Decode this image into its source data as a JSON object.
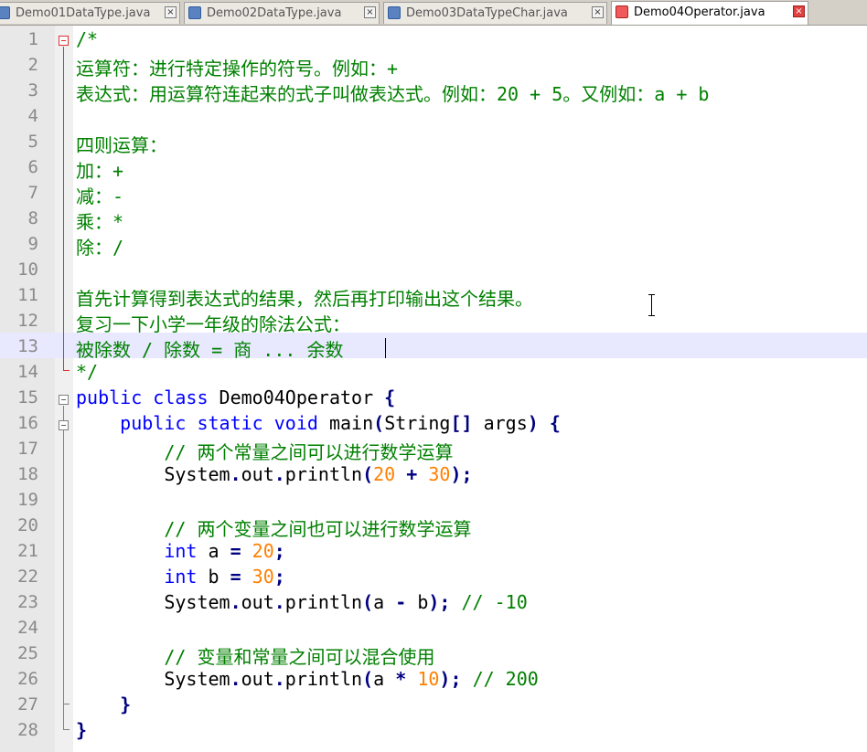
{
  "tabs": [
    {
      "label": "Demo01DataType.java",
      "active": false
    },
    {
      "label": "Demo02DataType.java",
      "active": false
    },
    {
      "label": "Demo03DataTypeChar.java",
      "active": false
    },
    {
      "label": "Demo04Operator.java",
      "active": true
    }
  ],
  "tab_close_glyph": "×",
  "colors": {
    "comment": "#008000",
    "keyword": "#0000ff",
    "number": "#ff8000",
    "operator": "#000080",
    "current_line": "#e8e8ff",
    "fold_marker": "#e03030"
  },
  "editor": {
    "current_line": 13,
    "lines": [
      {
        "n": "1",
        "tokens": [
          {
            "t": "/*",
            "c": "cmt"
          }
        ]
      },
      {
        "n": "2",
        "tokens": [
          {
            "t": "运算符：进行特定操作的符号。例如：+",
            "c": "cmt"
          }
        ]
      },
      {
        "n": "3",
        "tokens": [
          {
            "t": "表达式：用运算符连起来的式子叫做表达式。例如：20 + 5。又例如：a + b",
            "c": "cmt"
          }
        ]
      },
      {
        "n": "4",
        "tokens": []
      },
      {
        "n": "5",
        "tokens": [
          {
            "t": "四则运算：",
            "c": "cmt"
          }
        ]
      },
      {
        "n": "6",
        "tokens": [
          {
            "t": "加：+",
            "c": "cmt"
          }
        ]
      },
      {
        "n": "7",
        "tokens": [
          {
            "t": "减：-",
            "c": "cmt"
          }
        ]
      },
      {
        "n": "8",
        "tokens": [
          {
            "t": "乘：*",
            "c": "cmt"
          }
        ]
      },
      {
        "n": "9",
        "tokens": [
          {
            "t": "除：/",
            "c": "cmt"
          }
        ]
      },
      {
        "n": "10",
        "tokens": []
      },
      {
        "n": "11",
        "tokens": [
          {
            "t": "首先计算得到表达式的结果，然后再打印输出这个结果。",
            "c": "cmt"
          }
        ]
      },
      {
        "n": "12",
        "tokens": [
          {
            "t": "复习一下小学一年级的除法公式：",
            "c": "cmt"
          }
        ]
      },
      {
        "n": "13",
        "tokens": [
          {
            "t": "被除数 / 除数 = 商 ... 余数",
            "c": "cmt"
          }
        ]
      },
      {
        "n": "14",
        "tokens": [
          {
            "t": "*/",
            "c": "cmt"
          }
        ]
      },
      {
        "n": "15",
        "tokens": [
          {
            "t": "public class",
            "c": "kw"
          },
          {
            "t": " Demo04Operator ",
            "c": ""
          },
          {
            "t": "{",
            "c": "op"
          }
        ]
      },
      {
        "n": "16",
        "tokens": [
          {
            "t": "    ",
            "c": ""
          },
          {
            "t": "public static void",
            "c": "kw"
          },
          {
            "t": " main",
            "c": ""
          },
          {
            "t": "(",
            "c": "op"
          },
          {
            "t": "String",
            "c": ""
          },
          {
            "t": "[]",
            "c": "op"
          },
          {
            "t": " args",
            "c": ""
          },
          {
            "t": ")",
            "c": "op"
          },
          {
            "t": " ",
            "c": ""
          },
          {
            "t": "{",
            "c": "op"
          }
        ]
      },
      {
        "n": "17",
        "tokens": [
          {
            "t": "        ",
            "c": ""
          },
          {
            "t": "// 两个常量之间可以进行数学运算",
            "c": "cmt"
          }
        ]
      },
      {
        "n": "18",
        "tokens": [
          {
            "t": "        System",
            "c": ""
          },
          {
            "t": ".",
            "c": "op"
          },
          {
            "t": "out",
            "c": ""
          },
          {
            "t": ".",
            "c": "op"
          },
          {
            "t": "println",
            "c": ""
          },
          {
            "t": "(",
            "c": "op"
          },
          {
            "t": "20",
            "c": "num"
          },
          {
            "t": " ",
            "c": ""
          },
          {
            "t": "+",
            "c": "op"
          },
          {
            "t": " ",
            "c": ""
          },
          {
            "t": "30",
            "c": "num"
          },
          {
            "t": ");",
            "c": "op"
          }
        ]
      },
      {
        "n": "19",
        "tokens": []
      },
      {
        "n": "20",
        "tokens": [
          {
            "t": "        ",
            "c": ""
          },
          {
            "t": "// 两个变量之间也可以进行数学运算",
            "c": "cmt"
          }
        ]
      },
      {
        "n": "21",
        "tokens": [
          {
            "t": "        ",
            "c": ""
          },
          {
            "t": "int",
            "c": "kw"
          },
          {
            "t": " a ",
            "c": ""
          },
          {
            "t": "=",
            "c": "op"
          },
          {
            "t": " ",
            "c": ""
          },
          {
            "t": "20",
            "c": "num"
          },
          {
            "t": ";",
            "c": "op"
          }
        ]
      },
      {
        "n": "22",
        "tokens": [
          {
            "t": "        ",
            "c": ""
          },
          {
            "t": "int",
            "c": "kw"
          },
          {
            "t": " b ",
            "c": ""
          },
          {
            "t": "=",
            "c": "op"
          },
          {
            "t": " ",
            "c": ""
          },
          {
            "t": "30",
            "c": "num"
          },
          {
            "t": ";",
            "c": "op"
          }
        ]
      },
      {
        "n": "23",
        "tokens": [
          {
            "t": "        System",
            "c": ""
          },
          {
            "t": ".",
            "c": "op"
          },
          {
            "t": "out",
            "c": ""
          },
          {
            "t": ".",
            "c": "op"
          },
          {
            "t": "println",
            "c": ""
          },
          {
            "t": "(",
            "c": "op"
          },
          {
            "t": "a ",
            "c": ""
          },
          {
            "t": "-",
            "c": "op"
          },
          {
            "t": " b",
            "c": ""
          },
          {
            "t": ");",
            "c": "op"
          },
          {
            "t": " ",
            "c": ""
          },
          {
            "t": "// -10",
            "c": "cmt"
          }
        ]
      },
      {
        "n": "24",
        "tokens": []
      },
      {
        "n": "25",
        "tokens": [
          {
            "t": "        ",
            "c": ""
          },
          {
            "t": "// 变量和常量之间可以混合使用",
            "c": "cmt"
          }
        ]
      },
      {
        "n": "26",
        "tokens": [
          {
            "t": "        System",
            "c": ""
          },
          {
            "t": ".",
            "c": "op"
          },
          {
            "t": "out",
            "c": ""
          },
          {
            "t": ".",
            "c": "op"
          },
          {
            "t": "println",
            "c": ""
          },
          {
            "t": "(",
            "c": "op"
          },
          {
            "t": "a ",
            "c": ""
          },
          {
            "t": "*",
            "c": "op"
          },
          {
            "t": " ",
            "c": ""
          },
          {
            "t": "10",
            "c": "num"
          },
          {
            "t": ");",
            "c": "op"
          },
          {
            "t": " ",
            "c": ""
          },
          {
            "t": "// 200",
            "c": "cmt"
          }
        ]
      },
      {
        "n": "27",
        "tokens": [
          {
            "t": "    ",
            "c": ""
          },
          {
            "t": "}",
            "c": "op"
          }
        ]
      },
      {
        "n": "28",
        "tokens": [
          {
            "t": "}",
            "c": "op"
          }
        ]
      }
    ]
  }
}
